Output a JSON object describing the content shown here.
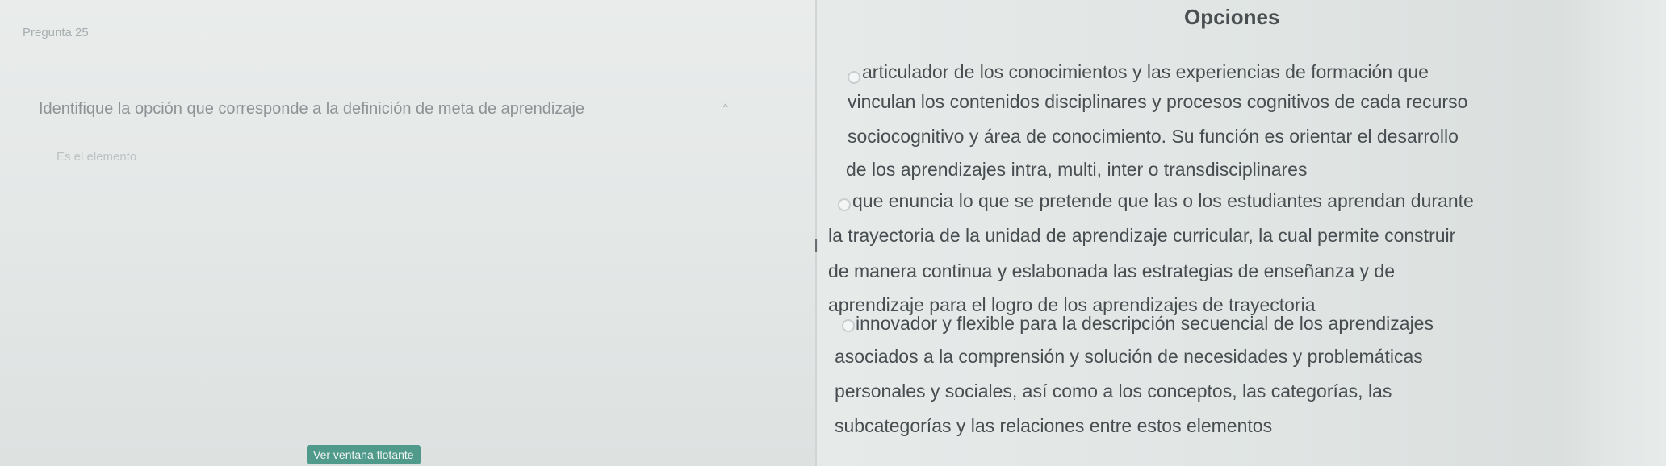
{
  "question": {
    "number_label": "Pregunta 25",
    "prompt": "Identifique la opción que corresponde a la definición de meta de aprendizaje",
    "element_text": "Es el elemento",
    "floating_window_button": "Ver ventana flotante"
  },
  "options_panel": {
    "title": "Opciones",
    "options": [
      {
        "lines": [
          "articulador de los conocimientos y las experiencias de formación que",
          "vinculan los contenidos disciplinares y procesos cognitivos de cada recurso",
          "sociocognitivo y área de conocimiento. Su función es orientar el desarrollo",
          "de los aprendizajes intra, multi, inter o transdisciplinares"
        ]
      },
      {
        "lines": [
          "que enuncia lo que se pretende que las o los estudiantes aprendan durante",
          "la trayectoria de la unidad de aprendizaje curricular, la cual permite construir",
          "de manera continua y eslabonada las estrategias de enseñanza y de",
          "aprendizaje para el logro de los aprendizajes de trayectoria"
        ]
      },
      {
        "lines": [
          "innovador y flexible para la descripción secuencial de los aprendizajes",
          "asociados a la comprensión y solución de necesidades y problemáticas",
          "personales y sociales, así como a los conceptos, las categorías, las",
          "subcategorías y las relaciones entre estos elementos"
        ]
      }
    ]
  }
}
